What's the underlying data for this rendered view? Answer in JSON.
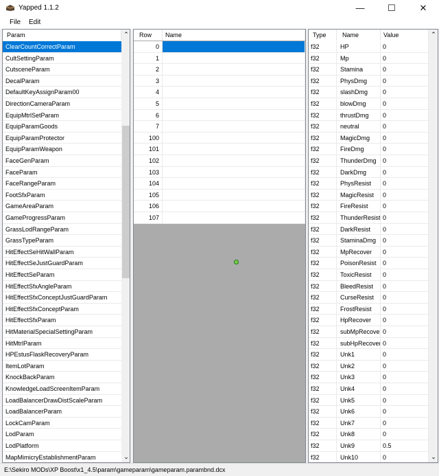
{
  "window": {
    "title": "Yapped 1.1.2",
    "minimize": "—",
    "maximize": "☐",
    "close": "✕"
  },
  "menu": {
    "file": "File",
    "edit": "Edit"
  },
  "params": {
    "header": "Param",
    "items": [
      "ClearCountCorrectParam",
      "CultSettingParam",
      "CutsceneParam",
      "DecalParam",
      "DefaultKeyAssignParam00",
      "DirectionCameraParam",
      "EquipMtrlSetParam",
      "EquipParamGoods",
      "EquipParamProtector",
      "EquipParamWeapon",
      "FaceGenParam",
      "FaceParam",
      "FaceRangeParam",
      "FootSfxParam",
      "GameAreaParam",
      "GameProgressParam",
      "GrassLodRangeParam",
      "GrassTypeParam",
      "HitEffectSeHitWallParam",
      "HitEffectSeJustGuardParam",
      "HitEffectSeParam",
      "HitEffectSfxAngleParam",
      "HitEffectSfxConceptJustGuardParam",
      "HitEffectSfxConceptParam",
      "HitEffectSfxParam",
      "HitMaterialSpecialSettingParam",
      "HitMtrlParam",
      "HPEstusFlaskRecoveryParam",
      "ItemLotParam",
      "KnockBackParam",
      "KnowledgeLoadScreenItemParam",
      "LoadBalancerDrawDistScaleParam",
      "LoadBalancerParam",
      "LockCamParam",
      "LodParam",
      "LodPlatform",
      "MapMimicryEstablishmentParam"
    ],
    "selected": 0
  },
  "rows": {
    "headers": {
      "row": "Row",
      "name": "Name"
    },
    "items": [
      {
        "id": "0",
        "name": ""
      },
      {
        "id": "1",
        "name": ""
      },
      {
        "id": "2",
        "name": ""
      },
      {
        "id": "3",
        "name": ""
      },
      {
        "id": "4",
        "name": ""
      },
      {
        "id": "5",
        "name": ""
      },
      {
        "id": "6",
        "name": ""
      },
      {
        "id": "7",
        "name": ""
      },
      {
        "id": "100",
        "name": ""
      },
      {
        "id": "101",
        "name": ""
      },
      {
        "id": "102",
        "name": ""
      },
      {
        "id": "103",
        "name": ""
      },
      {
        "id": "104",
        "name": ""
      },
      {
        "id": "105",
        "name": ""
      },
      {
        "id": "106",
        "name": ""
      },
      {
        "id": "107",
        "name": ""
      }
    ],
    "selected": 0
  },
  "cells": {
    "headers": {
      "type": "Type",
      "name": "Name",
      "value": "Value"
    },
    "items": [
      {
        "type": "f32",
        "name": "HP",
        "value": "0"
      },
      {
        "type": "f32",
        "name": "Mp",
        "value": "0"
      },
      {
        "type": "f32",
        "name": "Stamina",
        "value": "0"
      },
      {
        "type": "f32",
        "name": "PhysDmg",
        "value": "0"
      },
      {
        "type": "f32",
        "name": "slashDmg",
        "value": "0"
      },
      {
        "type": "f32",
        "name": "blowDmg",
        "value": "0"
      },
      {
        "type": "f32",
        "name": "thrustDmg",
        "value": "0"
      },
      {
        "type": "f32",
        "name": "neutral",
        "value": "0"
      },
      {
        "type": "f32",
        "name": "MagicDmg",
        "value": "0"
      },
      {
        "type": "f32",
        "name": "FireDmg",
        "value": "0"
      },
      {
        "type": "f32",
        "name": "ThunderDmg",
        "value": "0"
      },
      {
        "type": "f32",
        "name": "DarkDmg",
        "value": "0"
      },
      {
        "type": "f32",
        "name": "PhysResist",
        "value": "0"
      },
      {
        "type": "f32",
        "name": "MagicResist",
        "value": "0"
      },
      {
        "type": "f32",
        "name": "FireResist",
        "value": "0"
      },
      {
        "type": "f32",
        "name": "ThunderResist",
        "value": "0"
      },
      {
        "type": "f32",
        "name": "DarkResist",
        "value": "0"
      },
      {
        "type": "f32",
        "name": "StaminaDmg",
        "value": "0"
      },
      {
        "type": "f32",
        "name": "MpRecover",
        "value": "0"
      },
      {
        "type": "f32",
        "name": "PoisonResist",
        "value": "0"
      },
      {
        "type": "f32",
        "name": "ToxicResist",
        "value": "0"
      },
      {
        "type": "f32",
        "name": "BleedResist",
        "value": "0"
      },
      {
        "type": "f32",
        "name": "CurseResist",
        "value": "0"
      },
      {
        "type": "f32",
        "name": "FrostResist",
        "value": "0"
      },
      {
        "type": "f32",
        "name": "HpRecover",
        "value": "0"
      },
      {
        "type": "f32",
        "name": "subMpRecover",
        "value": "0"
      },
      {
        "type": "f32",
        "name": "subHpRecover",
        "value": "0"
      },
      {
        "type": "f32",
        "name": "Unk1",
        "value": "0"
      },
      {
        "type": "f32",
        "name": "Unk2",
        "value": "0"
      },
      {
        "type": "f32",
        "name": "Unk3",
        "value": "0"
      },
      {
        "type": "f32",
        "name": "Unk4",
        "value": "0"
      },
      {
        "type": "f32",
        "name": "Unk5",
        "value": "0"
      },
      {
        "type": "f32",
        "name": "Unk6",
        "value": "0"
      },
      {
        "type": "f32",
        "name": "Unk7",
        "value": "0"
      },
      {
        "type": "f32",
        "name": "Unk8",
        "value": "0"
      },
      {
        "type": "f32",
        "name": "Unk9",
        "value": "0.5"
      },
      {
        "type": "f32",
        "name": "Unk10",
        "value": "0"
      }
    ]
  },
  "status": {
    "path": "E:\\Sekiro MODs\\XP Boost\\x1_4.5\\param\\gameparam\\gameparam.parambnd.dcx"
  },
  "colors": {
    "selection": "#0078d7",
    "empty_area": "#ababab"
  }
}
